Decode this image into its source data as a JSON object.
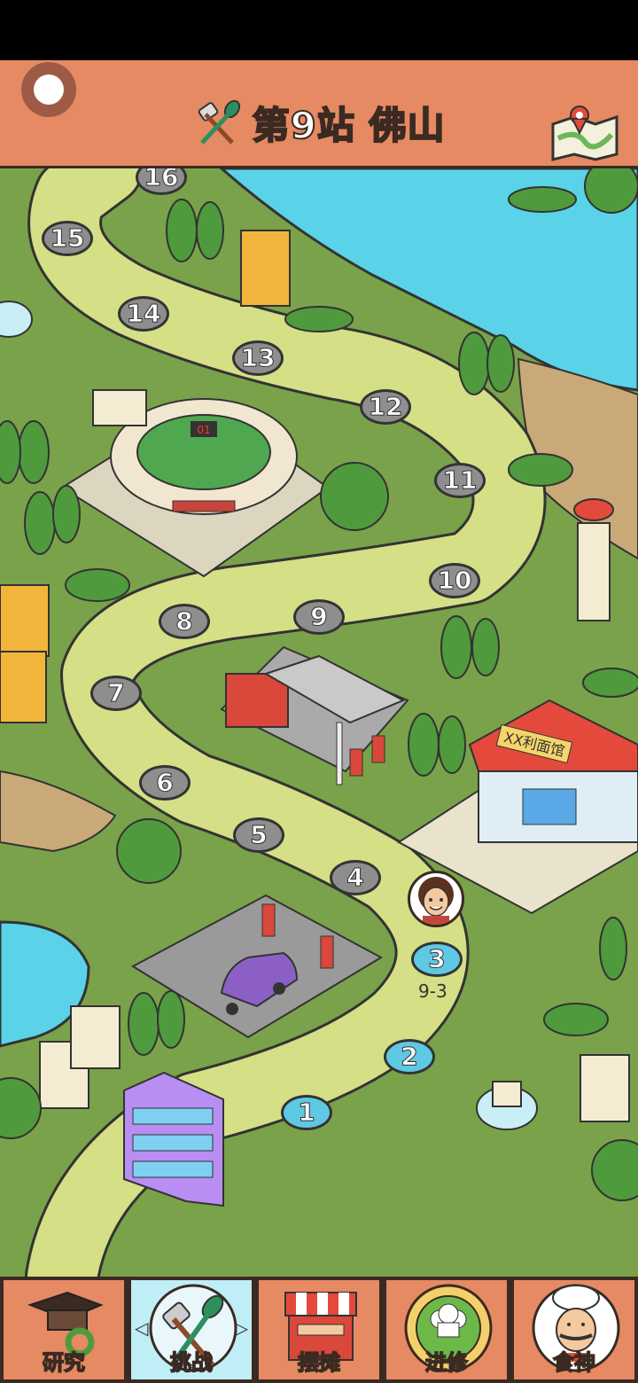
{
  "header": {
    "title": "第9站 佛山"
  },
  "map": {
    "nodes": [
      {
        "label": "1",
        "state": "done"
      },
      {
        "label": "2",
        "state": "done"
      },
      {
        "label": "3",
        "state": "done"
      },
      {
        "label": "4",
        "state": "locked"
      },
      {
        "label": "5",
        "state": "locked"
      },
      {
        "label": "6",
        "state": "locked"
      },
      {
        "label": "7",
        "state": "locked"
      },
      {
        "label": "8",
        "state": "locked"
      },
      {
        "label": "9",
        "state": "locked"
      },
      {
        "label": "10",
        "state": "locked"
      },
      {
        "label": "11",
        "state": "locked"
      },
      {
        "label": "12",
        "state": "locked"
      },
      {
        "label": "13",
        "state": "locked"
      },
      {
        "label": "14",
        "state": "locked"
      },
      {
        "label": "15",
        "state": "locked"
      },
      {
        "label": "16",
        "state": "locked"
      }
    ],
    "current_stage_label": "9-3",
    "restaurant_sign": "XX利面馆",
    "scoreboard": "01"
  },
  "bottom_nav": {
    "tabs": [
      {
        "label": "研究"
      },
      {
        "label": "挑战"
      },
      {
        "label": "摆摊"
      },
      {
        "label": "进修"
      },
      {
        "label": "食神"
      }
    ],
    "active": "挑战"
  },
  "colors": {
    "header": "#e68a64",
    "path": "#d4df86",
    "grass": "#7aa24a",
    "water": "#5ad3e8",
    "node_done": "#5fc8e3",
    "node_locked": "#8e8e8e"
  },
  "icons": [
    "toggle-icon",
    "utensils-icon",
    "map-icon",
    "graduation-cap-icon",
    "market-stall-icon",
    "chef-badge-icon",
    "chef-portrait-icon",
    "chevron-left-icon",
    "chevron-right-icon"
  ]
}
